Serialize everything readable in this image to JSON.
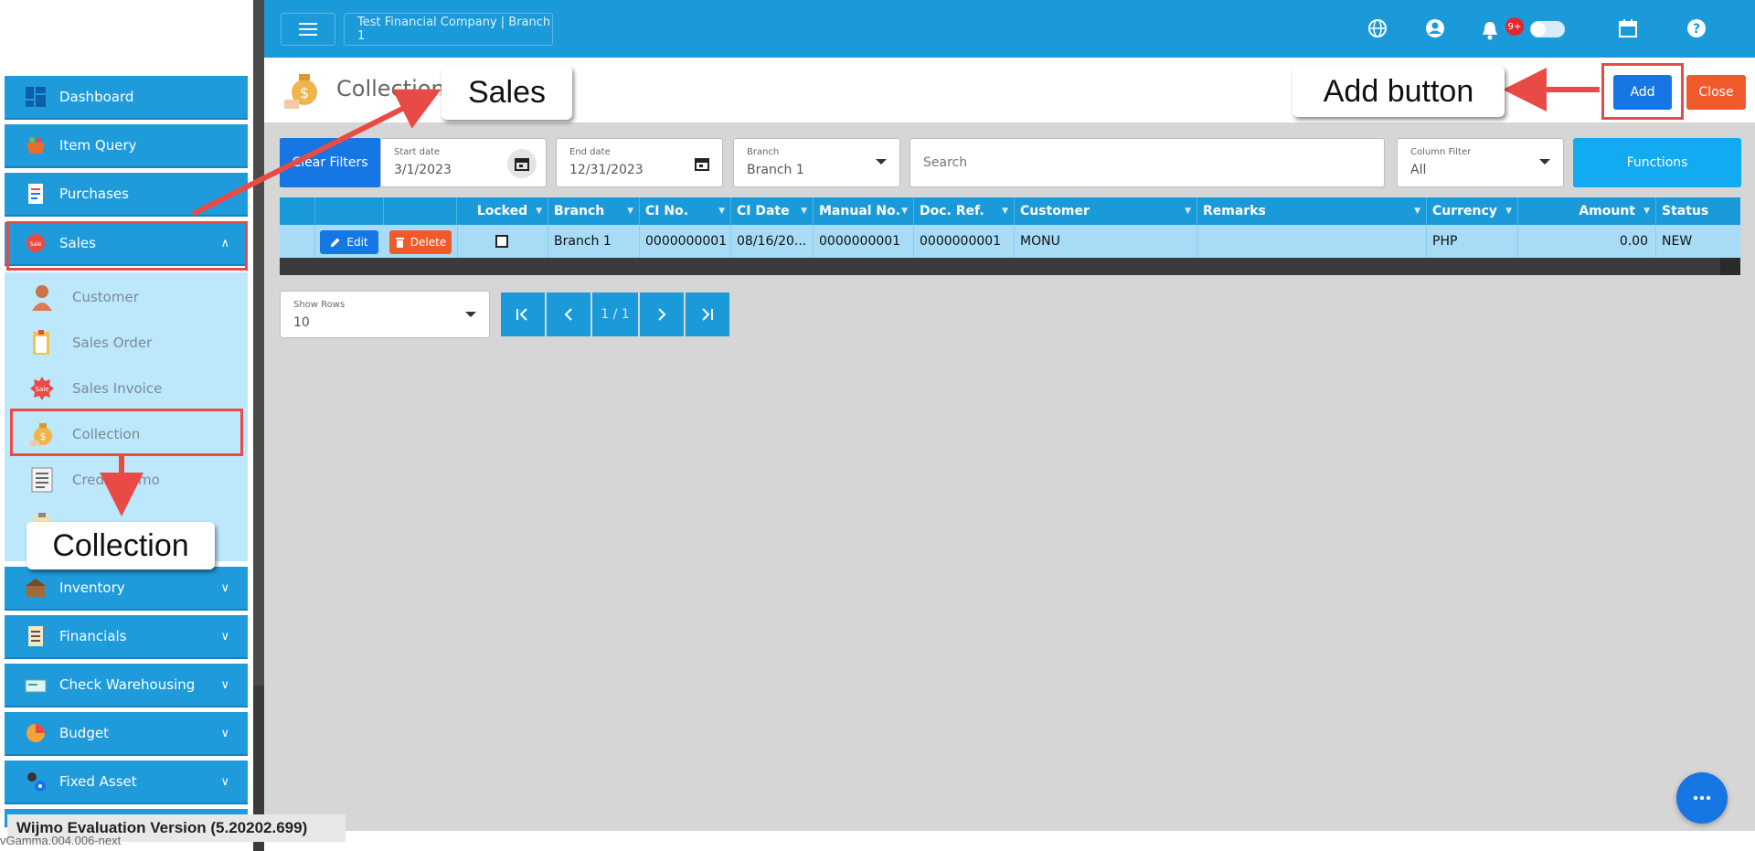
{
  "topbar": {
    "company": "Test Financial Company | Branch 1",
    "notification_count": "9+"
  },
  "sidebar": {
    "items": [
      {
        "label": "Dashboard"
      },
      {
        "label": "Item Query"
      },
      {
        "label": "Purchases"
      },
      {
        "label": "Sales"
      },
      {
        "label": "Inventory"
      },
      {
        "label": "Financials"
      },
      {
        "label": "Check Warehousing"
      },
      {
        "label": "Budget"
      },
      {
        "label": "Fixed Asset"
      }
    ],
    "sales_submenu": [
      {
        "label": "Customer"
      },
      {
        "label": "Sales Order"
      },
      {
        "label": "Sales Invoice"
      },
      {
        "label": "Collection"
      },
      {
        "label": "Credit Memo"
      }
    ]
  },
  "page": {
    "title": "Collection",
    "add_label": "Add",
    "close_label": "Close"
  },
  "filters": {
    "clear_label": "Clear Filters",
    "start_date_label": "Start date",
    "start_date": "3/1/2023",
    "end_date_label": "End date",
    "end_date": "12/31/2023",
    "branch_label": "Branch",
    "branch": "Branch 1",
    "search_placeholder": "Search",
    "column_filter_label": "Column Filter",
    "column_filter": "All",
    "functions_label": "Functions"
  },
  "grid": {
    "columns": [
      "Locked",
      "Branch",
      "CI No.",
      "CI Date",
      "Manual No.",
      "Doc. Ref.",
      "Customer",
      "Remarks",
      "Currency",
      "Amount",
      "Status"
    ],
    "edit_label": "Edit",
    "delete_label": "Delete",
    "row": {
      "branch": "Branch 1",
      "ci_no": "0000000001",
      "ci_date": "08/16/20...",
      "manual_no": "0000000001",
      "doc_ref": "0000000001",
      "customer": "MONU",
      "remarks": "",
      "currency": "PHP",
      "amount": "0.00",
      "status": "NEW"
    }
  },
  "pager": {
    "show_rows_label": "Show Rows",
    "show_rows": "10",
    "page": "1 / 1"
  },
  "footer": {
    "wijmo": "Wijmo Evaluation Version (5.20202.699)",
    "version": "vGamma.004.006-next"
  },
  "annotations": {
    "sales": "Sales",
    "collection": "Collection",
    "add_button": "Add button",
    "color": "#e84b45"
  }
}
